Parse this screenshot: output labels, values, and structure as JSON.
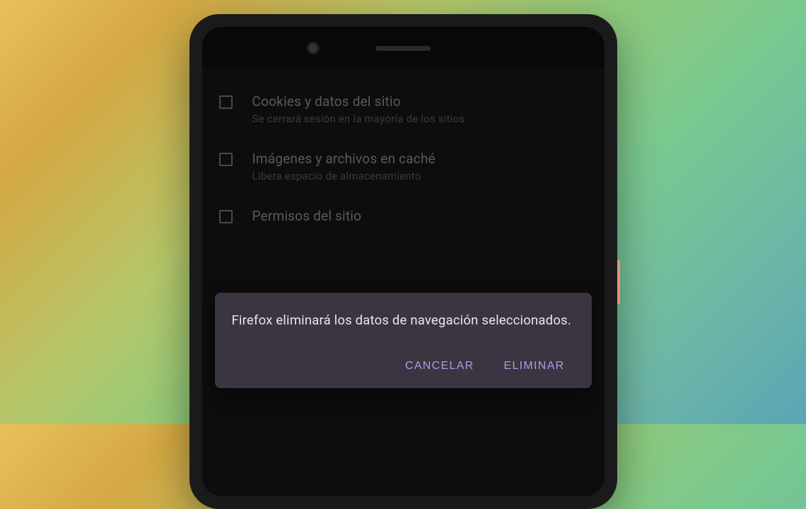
{
  "options": [
    {
      "title": "Cookies y datos del sitio",
      "subtitle": "Se cerrará sesión en la mayoría de los sitios"
    },
    {
      "title": "Imágenes y archivos en caché",
      "subtitle": "Libera espacio de almacenamiento"
    },
    {
      "title": "Permisos del sitio",
      "subtitle": ""
    }
  ],
  "dialog": {
    "message": "Firefox eliminará los datos de navegación seleccionados.",
    "cancel": "CANCELAR",
    "confirm": "ELIMINAR"
  }
}
